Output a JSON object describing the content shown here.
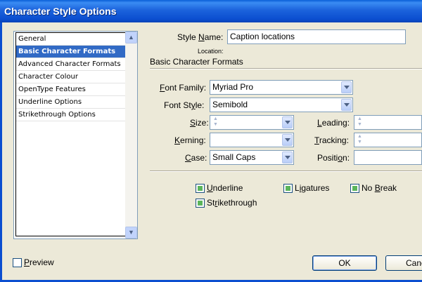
{
  "window": {
    "title": "Character Style Options"
  },
  "sidebar": {
    "items": [
      {
        "label": "General"
      },
      {
        "label": "Basic Character Formats"
      },
      {
        "label": "Advanced Character Formats"
      },
      {
        "label": "Character Colour"
      },
      {
        "label": "OpenType Features"
      },
      {
        "label": "Underline Options"
      },
      {
        "label": "Strikethrough Options"
      }
    ],
    "selected_index": 1
  },
  "style_name": {
    "label_pre": "Style ",
    "label_key": "N",
    "label_post": "ame:",
    "value": "Caption locations",
    "location_label": "Location:"
  },
  "section": {
    "title": "Basic Character Formats"
  },
  "fields": {
    "font_family": {
      "label_pre": "",
      "label_key": "F",
      "label_post": "ont Family:",
      "value": "Myriad Pro"
    },
    "font_style": {
      "label_pre": "Font St",
      "label_key": "y",
      "label_post": "le:",
      "value": "Semibold"
    },
    "size": {
      "label_pre": "",
      "label_key": "S",
      "label_post": "ize:",
      "value": ""
    },
    "leading": {
      "label_pre": "",
      "label_key": "L",
      "label_post": "eading:",
      "value": ""
    },
    "kerning": {
      "label_pre": "",
      "label_key": "K",
      "label_post": "erning:",
      "value": ""
    },
    "tracking": {
      "label_pre": "",
      "label_key": "T",
      "label_post": "racking:",
      "value": ""
    },
    "case": {
      "label_pre": "",
      "label_key": "C",
      "label_post": "ase:",
      "value": "Small Caps"
    },
    "position": {
      "label_pre": "Positi",
      "label_key": "o",
      "label_post": "n:",
      "value": ""
    }
  },
  "checkboxes": {
    "underline": {
      "label_pre": "",
      "label_key": "U",
      "label_post": "nderline"
    },
    "ligatures": {
      "label_pre": "L",
      "label_key": "i",
      "label_post": "gatures"
    },
    "no_break": {
      "label_pre": "No ",
      "label_key": "B",
      "label_post": "reak"
    },
    "strikethrough": {
      "label_pre": "St",
      "label_key": "r",
      "label_post": "ikethrough"
    }
  },
  "preview": {
    "label_pre": "",
    "label_key": "P",
    "label_post": "review"
  },
  "buttons": {
    "ok": "OK",
    "cancel": "Canc"
  }
}
